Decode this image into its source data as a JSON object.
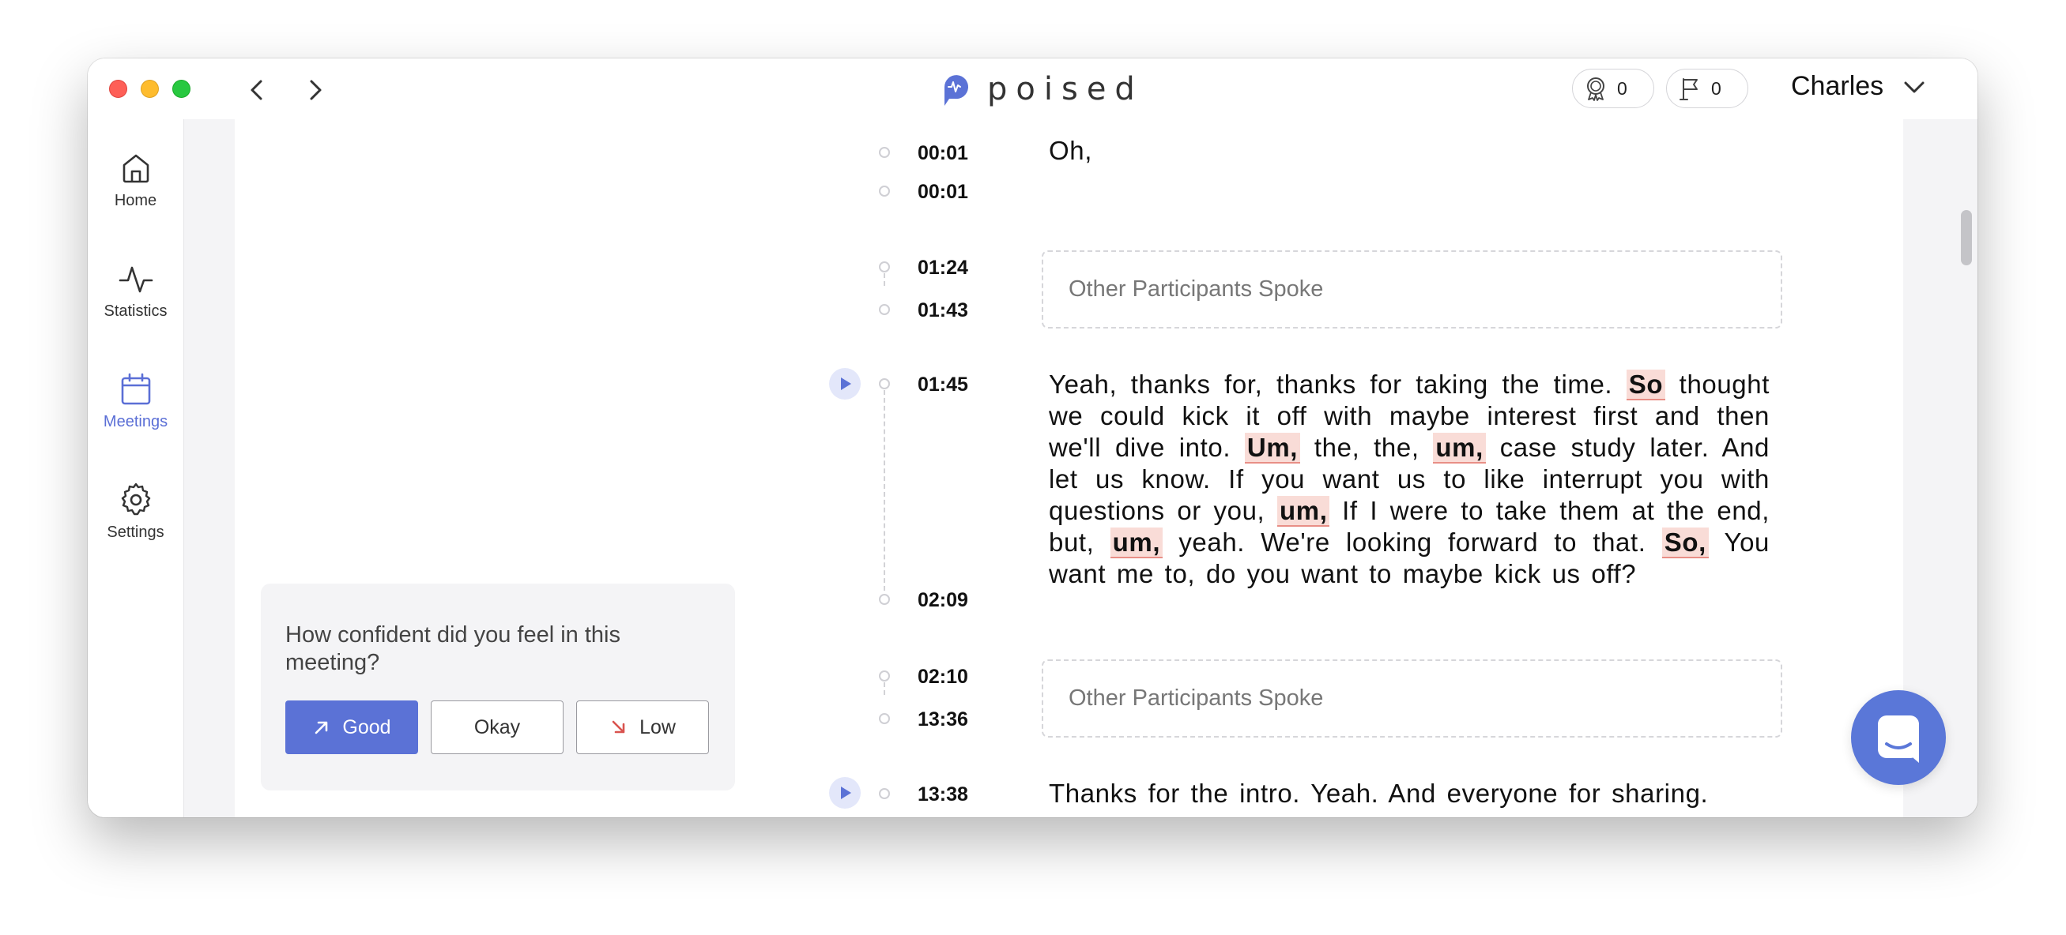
{
  "app": {
    "logo_text": "poised"
  },
  "header": {
    "badges": [
      {
        "icon": "award-icon",
        "count": "0"
      },
      {
        "icon": "flag-icon",
        "count": "0"
      }
    ],
    "user_name": "Charles"
  },
  "sidebar": {
    "items": [
      {
        "label": "Home",
        "icon": "home-icon",
        "active": false
      },
      {
        "label": "Statistics",
        "icon": "activity-icon",
        "active": false
      },
      {
        "label": "Meetings",
        "icon": "calendar-icon",
        "active": true
      },
      {
        "label": "Settings",
        "icon": "gear-icon",
        "active": false
      }
    ]
  },
  "survey": {
    "question": "How confident did you feel in this meeting?",
    "options": [
      "Good",
      "Okay",
      "Low"
    ]
  },
  "transcript": {
    "segments": [
      {
        "type": "speech",
        "start": "00:01",
        "end": "00:01",
        "text": "Oh,"
      },
      {
        "type": "other",
        "start": "01:24",
        "end": "01:43",
        "label": "Other Participants Spoke"
      },
      {
        "type": "speech",
        "start": "01:45",
        "end": "02:09",
        "parts": [
          "Yeah, thanks for, thanks for taking the time. ",
          "So",
          " thought we could kick it off with maybe interest first and then we'll dive into. ",
          "Um,",
          " the, the, ",
          "um,",
          " case study later. And let us know. If you want us to like interrupt you with questions or you, ",
          "um,",
          " If I were to take them at the end, but, ",
          "um,",
          " yeah. We're looking forward to that. ",
          "So,",
          " You want me to, do you want to maybe kick us off?"
        ]
      },
      {
        "type": "other",
        "start": "02:10",
        "end": "13:36",
        "label": "Other Participants Spoke"
      },
      {
        "type": "speech",
        "start": "13:38",
        "text": "Thanks for the intro. Yeah. And everyone for sharing."
      }
    ]
  },
  "colors": {
    "accent": "#5b72d6",
    "filler_bg": "#f9dcd7",
    "filler_underline": "#e88f86",
    "chat_fab": "#5a77d8"
  }
}
